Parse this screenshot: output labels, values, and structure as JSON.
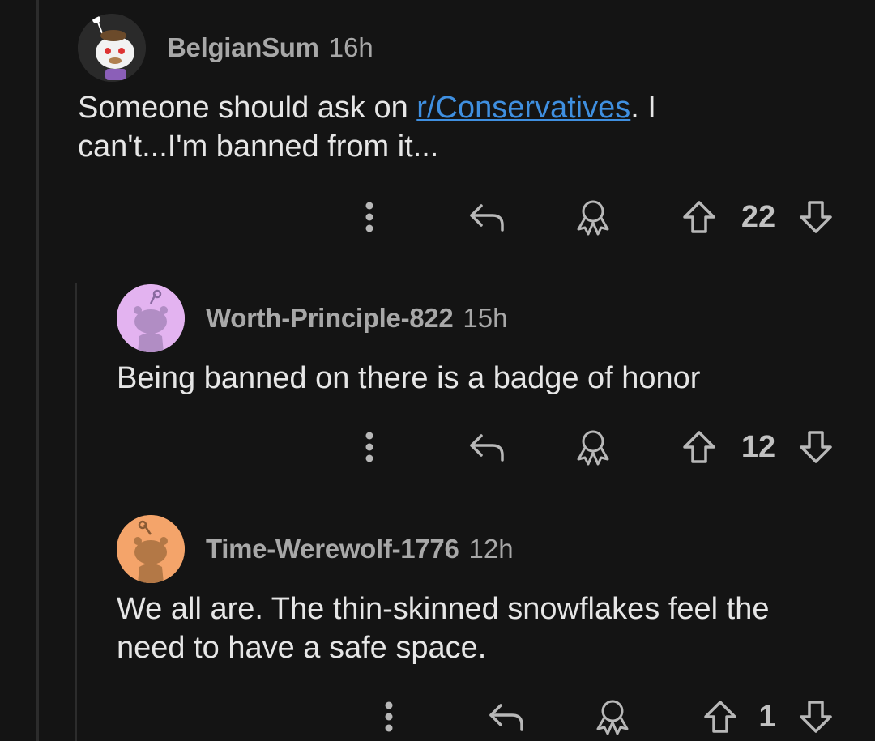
{
  "comments": [
    {
      "author": "BelgianSum",
      "time": "16h",
      "text_before": "Someone should ask on ",
      "link": "r/Conservatives",
      "text_after": ". I can't...I'm banned from it...",
      "score": "22",
      "avatar_color": "#2b2b2b"
    },
    {
      "author": "Worth-Principle-822",
      "time": "15h",
      "text": "Being banned on there is a badge of honor",
      "score": "12",
      "avatar_color": "#e3b3f0"
    },
    {
      "author": "Time-Werewolf-1776",
      "time": "12h",
      "text": "We all are.  The thin-skinned snowflakes feel the need to have a safe space.",
      "score": "1",
      "avatar_color": "#f4a46a"
    }
  ],
  "icons": {
    "more": "more-vertical-icon",
    "reply": "reply-icon",
    "award": "award-icon",
    "upvote": "upvote-icon",
    "downvote": "downvote-icon"
  }
}
